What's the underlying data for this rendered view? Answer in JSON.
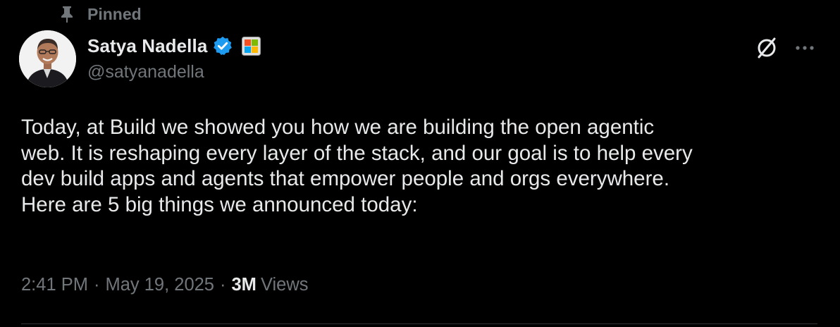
{
  "pinned": {
    "label": "Pinned",
    "icon": "pin-icon"
  },
  "author": {
    "display_name": "Satya Nadella",
    "handle": "@satyanadella",
    "verified_icon": "verified-badge-icon",
    "affiliate_icon": "microsoft-affiliate-badge-icon",
    "avatar_icon": "avatar"
  },
  "actions": {
    "grok_icon": "grok-icon",
    "more_icon": "more-icon"
  },
  "tweet": {
    "text": "Today, at Build we showed you how we are building the open agentic\nweb. It is reshaping every layer of the stack, and our goal is to help every\ndev build apps and agents that empower people and orgs everywhere.\nHere are 5 big things we announced today:"
  },
  "meta": {
    "time": "2:41 PM",
    "separator": "·",
    "date": "May 19, 2025",
    "views_count": "3M",
    "views_label": "Views"
  },
  "colors": {
    "background": "#000000",
    "text": "#e7e9ea",
    "secondary": "#71767b",
    "verified": "#1d9bf0",
    "divider": "#2f3336"
  }
}
